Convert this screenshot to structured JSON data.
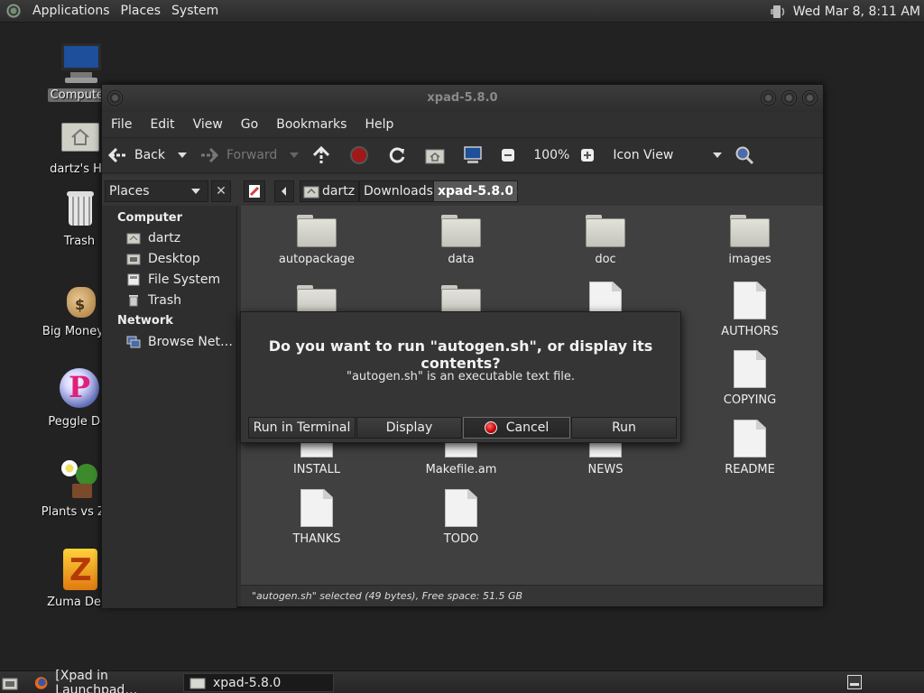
{
  "top_panel": {
    "menus": [
      "Applications",
      "Places",
      "System"
    ],
    "clock": "Wed Mar  8,  8:11 AM",
    "icons": {
      "logo": "gnome-foot-icon",
      "volume": "volume-icon"
    }
  },
  "desktop": {
    "icons": [
      {
        "label": "Computer",
        "icon": "computer-icon",
        "selected": true
      },
      {
        "label": "dartz's Ho",
        "icon": "home-folder-icon"
      },
      {
        "label": "Trash",
        "icon": "trash-icon"
      },
      {
        "label": "Big Money D",
        "icon": "money-bag-icon"
      },
      {
        "label": "Peggle Del",
        "icon": "peggle-icon"
      },
      {
        "label": "Plants vs Zor",
        "icon": "plants-icon"
      },
      {
        "label": "Zuma Delu",
        "icon": "zuma-icon"
      }
    ]
  },
  "window": {
    "title": "xpad-5.8.0",
    "menubar": [
      "File",
      "Edit",
      "View",
      "Go",
      "Bookmarks",
      "Help"
    ],
    "toolbar": {
      "back": "Back",
      "forward": "Forward",
      "zoom": "100%",
      "view_mode": "Icon View"
    },
    "location": {
      "side_pane": "Places",
      "crumbs": [
        "dartz",
        "Downloads",
        "xpad-5.8.0"
      ]
    },
    "sidebar": {
      "sections": [
        {
          "heading": "Computer",
          "items": [
            "dartz",
            "Desktop",
            "File System",
            "Trash"
          ]
        },
        {
          "heading": "Network",
          "items": [
            "Browse Net…"
          ]
        }
      ]
    },
    "files": [
      {
        "name": "autopackage",
        "type": "folder"
      },
      {
        "name": "data",
        "type": "folder"
      },
      {
        "name": "doc",
        "type": "folder"
      },
      {
        "name": "images",
        "type": "folder"
      },
      {
        "name": "AUTHORS",
        "type": "file"
      },
      {
        "name": "COPYING",
        "type": "file"
      },
      {
        "name": "INSTALL",
        "type": "file"
      },
      {
        "name": "Makefile.am",
        "type": "file"
      },
      {
        "name": "NEWS",
        "type": "file"
      },
      {
        "name": "README",
        "type": "file"
      },
      {
        "name": "THANKS",
        "type": "file"
      },
      {
        "name": "TODO",
        "type": "file"
      }
    ],
    "status": "\"autogen.sh\" selected (49 bytes), Free space: 51.5 GB"
  },
  "dialog": {
    "title": "Do you want to run \"autogen.sh\", or display its contents?",
    "message": "\"autogen.sh\" is an executable text file.",
    "buttons": {
      "run_in_terminal": "Run in Terminal",
      "display": "Display",
      "cancel": "Cancel",
      "run": "Run"
    }
  },
  "taskbar": {
    "tasks": [
      "[Xpad in Launchpad…",
      "xpad-5.8.0"
    ]
  }
}
